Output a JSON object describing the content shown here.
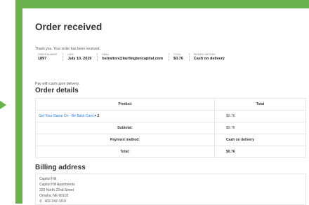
{
  "page": {
    "title": "Order received",
    "thank_you": "Thank you. Your order has been received."
  },
  "overview": [
    {
      "label": "ORDER NUMBER",
      "value": "1897"
    },
    {
      "label": "DATE",
      "value": "July 10, 2019"
    },
    {
      "label": "EMAIL",
      "value": "bstratton@burlingtoncapital.com"
    },
    {
      "label": "TOTAL",
      "value": "$0.76"
    },
    {
      "label": "PAYMENT METHOD",
      "value": "Cash on delivery"
    }
  ],
  "payment_note": "Pay with cash upon delivery.",
  "order_details": {
    "heading": "Order details",
    "headers": {
      "product": "Product",
      "total": "Total"
    },
    "items": [
      {
        "name": "Get Your Game On - Be Back Card",
        "qty": "× 2",
        "total": "$0.76"
      }
    ],
    "subtotal_label": "Subtotal:",
    "subtotal_value": "$0.76",
    "payment_method_label": "Payment method:",
    "payment_method_value": "Cash on delivery",
    "total_label": "Total:",
    "total_value": "$0.76"
  },
  "billing": {
    "heading": "Billing address",
    "lines": [
      "Capitol Hill",
      "Capitol Hill Apartments",
      "320 North 22nd Street",
      "Omaha, NE 68102"
    ],
    "phone": "402-342-1119",
    "phone_icon": "phone-icon"
  },
  "colors": {
    "frame": "#6ab04c",
    "link": "#2a7ae2"
  }
}
